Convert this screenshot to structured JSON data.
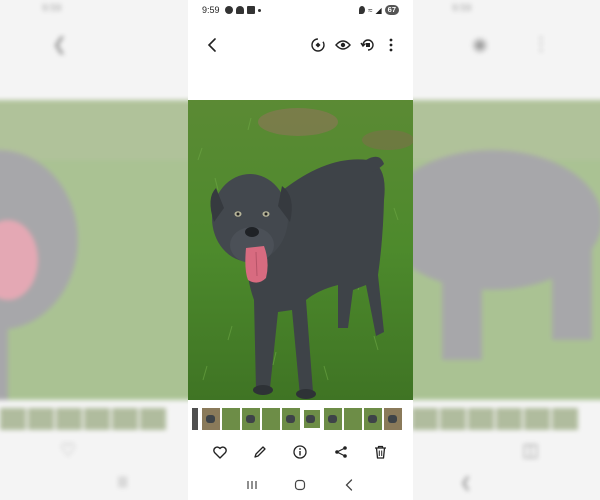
{
  "status_bar": {
    "time": "9:59",
    "battery": "67"
  },
  "background_ghost": {
    "time_left": "9:59",
    "time_right": "9:59"
  },
  "colors": {
    "grass": "#4c7a2e",
    "dog_coat": "#3e4348",
    "tongue": "#d86b80",
    "icon": "#222222"
  },
  "top_bar_icons": [
    "back-arrow-icon",
    "remaster-icon",
    "eye-icon",
    "rotate-icon",
    "more-vertical-icon"
  ],
  "action_bar_icons": [
    "heart-icon",
    "pencil-icon",
    "info-icon",
    "share-icon",
    "trash-icon"
  ],
  "nav_bar_icons": [
    "recent-apps-icon",
    "home-icon",
    "back-nav-icon"
  ]
}
